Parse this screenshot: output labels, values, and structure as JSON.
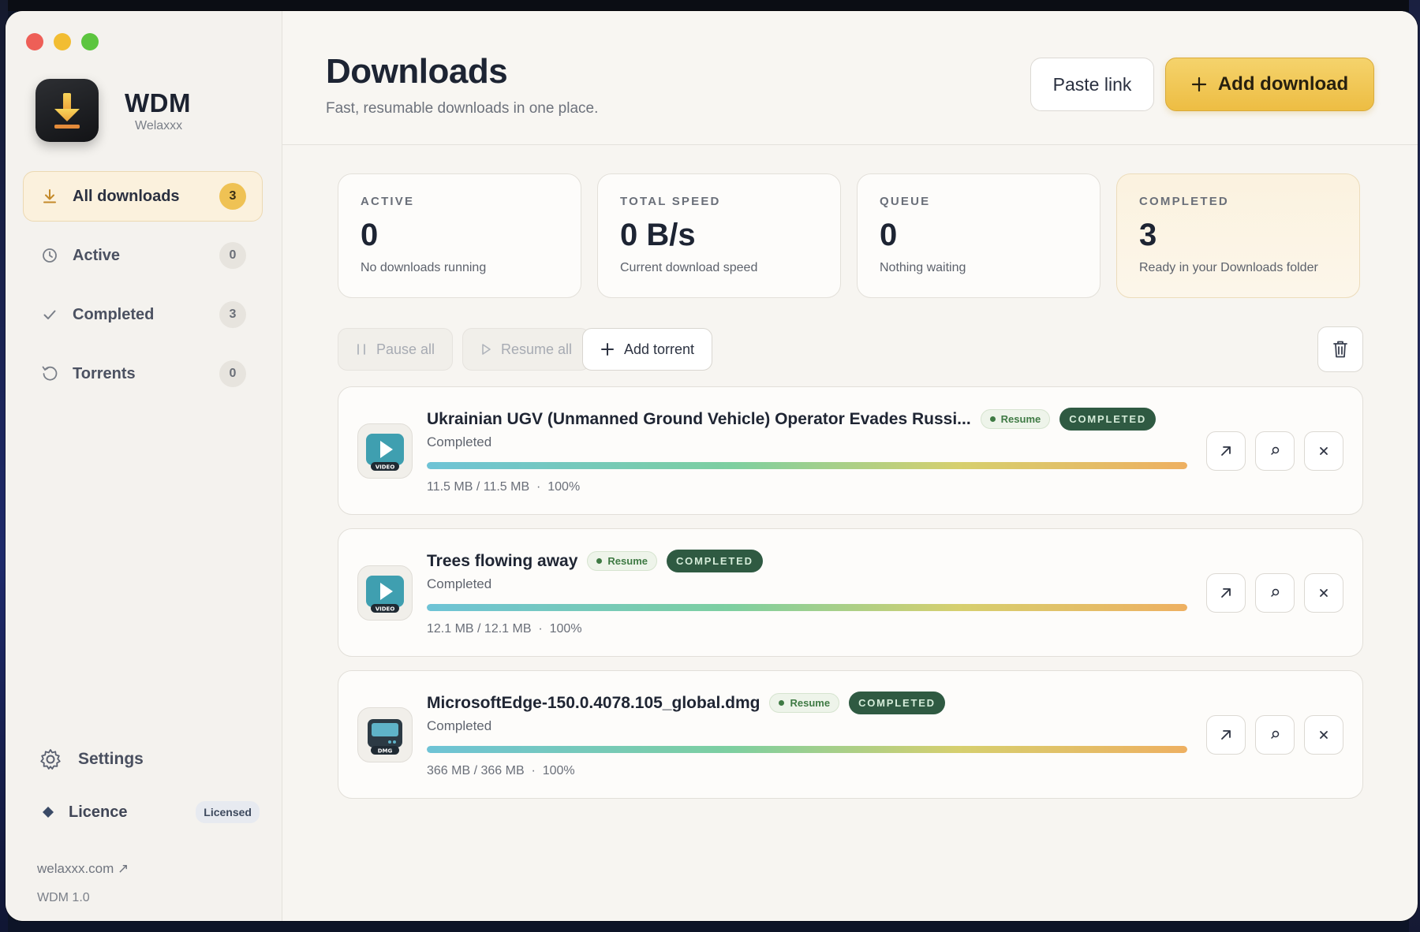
{
  "app": {
    "name": "WDM",
    "subtitle": "Welaxxx"
  },
  "sidebar": {
    "items": [
      {
        "label": "All downloads",
        "count": "3",
        "icon": "download-icon"
      },
      {
        "label": "Active",
        "count": "0",
        "icon": "clock-icon"
      },
      {
        "label": "Completed",
        "count": "3",
        "icon": "check-icon"
      },
      {
        "label": "Torrents",
        "count": "0",
        "icon": "refresh-icon"
      }
    ],
    "settings_label": "Settings",
    "licence_label": "Licence",
    "licence_badge": "Licensed",
    "site_link": "welaxxx.com ↗",
    "version": "WDM 1.0"
  },
  "header": {
    "title": "Downloads",
    "subtitle": "Fast, resumable downloads in one place.",
    "paste_label": "Paste link",
    "add_label": "Add download"
  },
  "stats": [
    {
      "label": "ACTIVE",
      "value": "0",
      "desc": "No downloads running"
    },
    {
      "label": "TOTAL SPEED",
      "value": "0 B/s",
      "desc": "Current download speed"
    },
    {
      "label": "QUEUE",
      "value": "0",
      "desc": "Nothing waiting"
    },
    {
      "label": "COMPLETED",
      "value": "3",
      "desc": "Ready in your Downloads folder"
    }
  ],
  "toolbar": {
    "pause_all": "Pause all",
    "resume_all": "Resume all",
    "add_torrent": "Add torrent"
  },
  "downloads": [
    {
      "title": "Ukrainian UGV (Unmanned Ground Vehicle) Operator Evades Russi...",
      "resume": "Resume",
      "badge": "COMPLETED",
      "status": "Completed",
      "size": "11.5 MB / 11.5 MB",
      "percent": "100%",
      "progress": 1.0,
      "type": "VIDEO"
    },
    {
      "title": "Trees flowing away",
      "resume": "Resume",
      "badge": "COMPLETED",
      "status": "Completed",
      "size": "12.1 MB / 12.1 MB",
      "percent": "100%",
      "progress": 1.0,
      "type": "VIDEO"
    },
    {
      "title": "MicrosoftEdge-150.0.4078.105_global.dmg",
      "resume": "Resume",
      "badge": "COMPLETED",
      "status": "Completed",
      "size": "366 MB / 366 MB",
      "percent": "100%",
      "progress": 1.0,
      "type": "DMG"
    }
  ],
  "colors": {
    "accent": "#edbd43",
    "completed_badge": "#2f5a42",
    "resume_green": "#3f7a44"
  }
}
